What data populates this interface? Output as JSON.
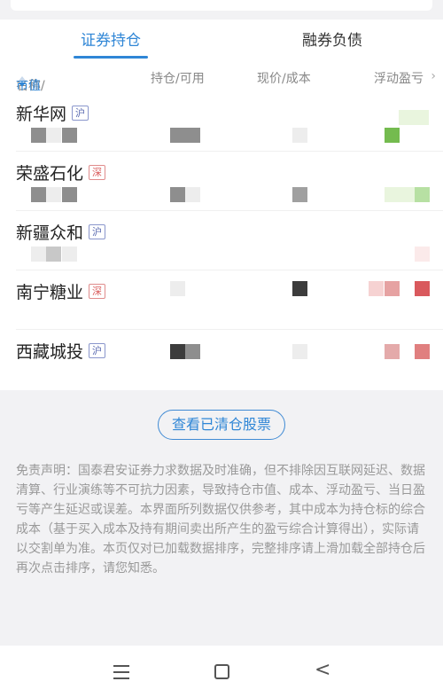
{
  "tabs": {
    "active": "证券持仓",
    "other": "融券负债"
  },
  "columns": {
    "name_prefix": "名称/",
    "name_sort": "市值",
    "position": "持仓/可用",
    "price": "现价/成本",
    "pnl": "浮动盈亏",
    "more": "›"
  },
  "holdings": [
    {
      "name": "新华网",
      "market": "沪"
    },
    {
      "name": "荣盛石化",
      "market": "深"
    },
    {
      "name": "新疆众和",
      "market": "沪"
    },
    {
      "name": "南宁糖业",
      "market": "深"
    },
    {
      "name": "西藏城投",
      "market": "沪"
    }
  ],
  "clear_button": "查看已清仓股票",
  "disclaimer": "免责声明：国泰君安证券力求数据及时准确，但不排除因互联网延迟、数据清算、行业演练等不可抗力因素，导致持仓市值、成本、浮动盈亏、当日盈亏等产生延迟或误差。本界面所列数据仅供参考，其中成本为持仓标的综合成本（基于买入成本及持有期间卖出所产生的盈亏综合计算得出），实际请以交割单为准。本页仅对已加载数据排序，完整排序请上滑加载全部持仓后再次点击排序，请您知悉。",
  "navigation": {
    "menu_icon": "menu-icon",
    "home_icon": "home-square-icon",
    "back_icon": "back-chevron-icon",
    "back_glyph": "<"
  },
  "colors": {
    "accent": "#2f86d6",
    "gain": "#d9595d",
    "loss": "#74bb4f"
  }
}
